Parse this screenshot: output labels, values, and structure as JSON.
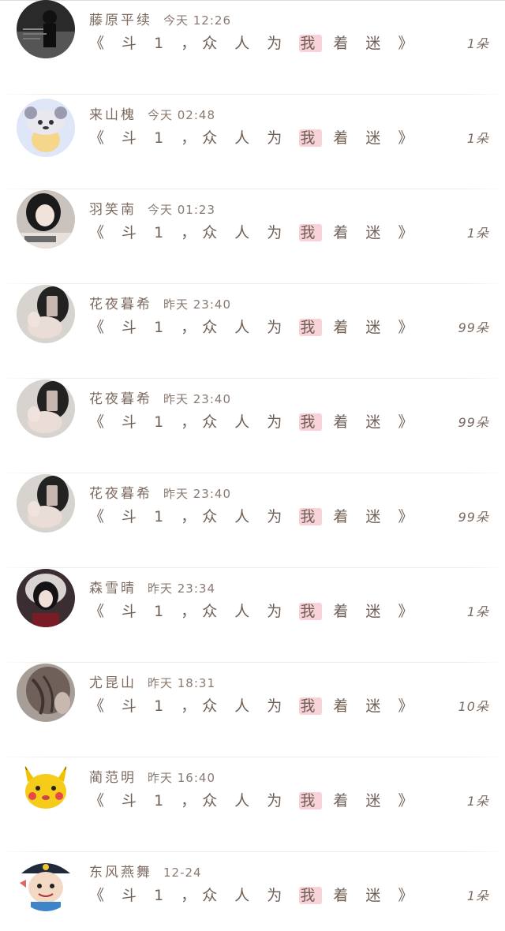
{
  "messages": [
    {
      "username": "藤原平续",
      "time": "今天 12:26",
      "text_pre": "《 斗 1 ，众 人 为 ",
      "text_hl": "我",
      "text_post": " 着 迷 》",
      "count": "1朵",
      "avatar": "dark-photo-avatar"
    },
    {
      "username": "来山槐",
      "time": "今天 02:48",
      "text_pre": "《 斗 1 ，众 人 为 ",
      "text_hl": "我",
      "text_post": " 着 迷 》",
      "count": "1朵",
      "avatar": "cartoon-animal-hat-avatar"
    },
    {
      "username": "羽笑南",
      "time": "今天 01:23",
      "text_pre": "《 斗 1 ，众 人 为 ",
      "text_hl": "我",
      "text_post": " 着 迷 》",
      "count": "1朵",
      "avatar": "girl-photo-avatar"
    },
    {
      "username": "花夜暮希",
      "time": "昨天 23:40",
      "text_pre": "《 斗 1 ，众 人 为 ",
      "text_hl": "我",
      "text_post": " 着 迷 》",
      "count": "99朵",
      "avatar": "selfie-photo-avatar"
    },
    {
      "username": "花夜暮希",
      "time": "昨天 23:40",
      "text_pre": "《 斗 1 ，众 人 为 ",
      "text_hl": "我",
      "text_post": " 着 迷 》",
      "count": "99朵",
      "avatar": "selfie-photo-avatar"
    },
    {
      "username": "花夜暮希",
      "time": "昨天 23:40",
      "text_pre": "《 斗 1 ，众 人 为 ",
      "text_hl": "我",
      "text_post": " 着 迷 》",
      "count": "99朵",
      "avatar": "selfie-photo-avatar"
    },
    {
      "username": "森雪晴",
      "time": "昨天 23:34",
      "text_pre": "《 斗 1 ，众 人 为 ",
      "text_hl": "我",
      "text_post": " 着 迷 》",
      "count": "1朵",
      "avatar": "hooded-girl-avatar"
    },
    {
      "username": "尤昆山",
      "time": "昨天 18:31",
      "text_pre": "《 斗 1 ，众 人 为 ",
      "text_hl": "我",
      "text_post": " 着 迷 》",
      "count": "10朵",
      "avatar": "hair-photo-avatar"
    },
    {
      "username": "蔺范明",
      "time": "昨天 16:40",
      "text_pre": "《 斗 1 ，众 人 为 ",
      "text_hl": "我",
      "text_post": " 着 迷 》",
      "count": "1朵",
      "avatar": "pikachu-avatar"
    },
    {
      "username": "东风燕舞",
      "time": "12-24",
      "text_pre": "《 斗 1 ，众 人 为 ",
      "text_hl": "我",
      "text_post": " 着 迷 》",
      "count": "1朵",
      "avatar": "cartoon-pirate-avatar"
    }
  ],
  "colors": {
    "username": "#7d6a60",
    "message": "#6f5f55",
    "highlight": "#f7d3d9",
    "divider": "#ececec"
  }
}
